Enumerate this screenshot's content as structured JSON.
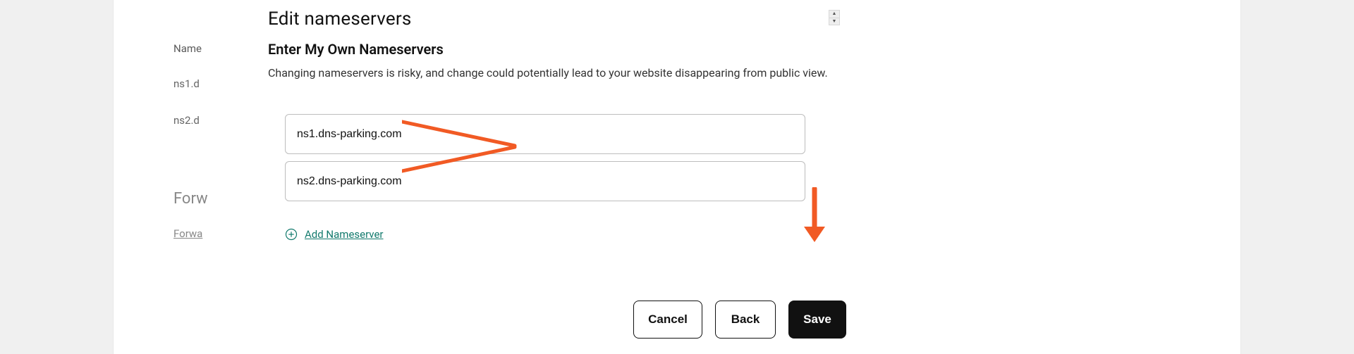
{
  "background": {
    "label": "Name",
    "ns1": "ns1.d",
    "ns2": "ns2.d",
    "forwarding_title": "Forw",
    "forwarding_link": "Forwa"
  },
  "modal": {
    "title": "Edit nameservers",
    "subtitle": "Enter My Own Nameservers",
    "warning": "Changing nameservers is risky, and change could potentially lead to your website disappearing from public view.",
    "nameservers": {
      "ns1": "ns1.dns-parking.com",
      "ns2": "ns2.dns-parking.com"
    },
    "add_nameserver_label": "Add Nameserver",
    "buttons": {
      "cancel": "Cancel",
      "back": "Back",
      "save": "Save"
    }
  },
  "annotation": {
    "arrow_color": "#f15a24"
  }
}
